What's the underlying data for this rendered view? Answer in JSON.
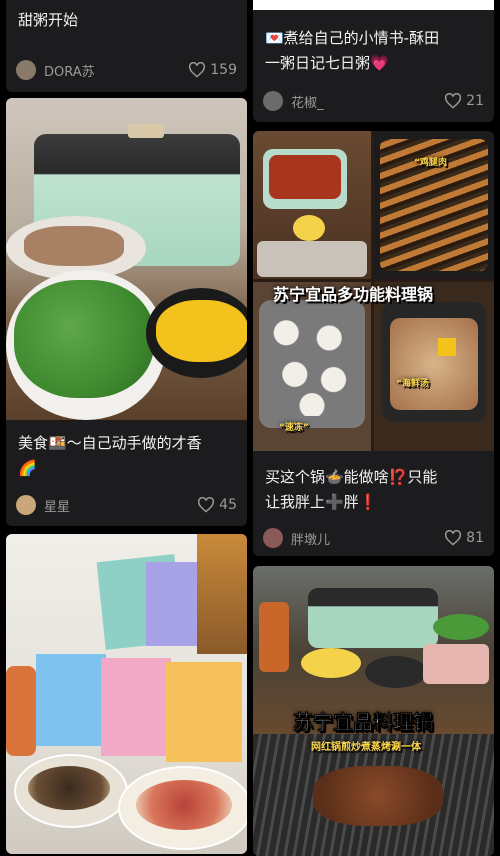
{
  "feed": {
    "left": [
      {
        "title_tail": "甜粥开始",
        "author": "DORA苏",
        "likes": "159"
      },
      {
        "title_line1": "美食🍱～自己动手做的才香",
        "title_line2": "🌈",
        "author": "星星",
        "likes": "45"
      },
      {
        "image_label": "snack-packages"
      }
    ],
    "right": [
      {
        "title_line1": "💌煮给自己的小情书-酥田",
        "title_line2": "一粥日记七日粥💗",
        "author": "花椒_",
        "likes": "21"
      },
      {
        "overlay": "苏宁宜品多功能料理锅",
        "tag1": "“鸡腿肉",
        "tag2": "“速冻”",
        "tag3": "“海鲜汤",
        "title_line1": "买这个锅🍲能做啥⁉️只能",
        "title_line2": "让我胖上➕胖❗",
        "author": "胖墩儿",
        "likes": "81"
      },
      {
        "overlay": "苏宁宜品料理锅",
        "sub_overlay": "网红锅煎炒煮蒸烤涮一体"
      }
    ]
  },
  "colors": {
    "background": "#000000",
    "card": "#1c1c1e",
    "text": "#f2f2f2",
    "muted": "#9a9a9a"
  }
}
